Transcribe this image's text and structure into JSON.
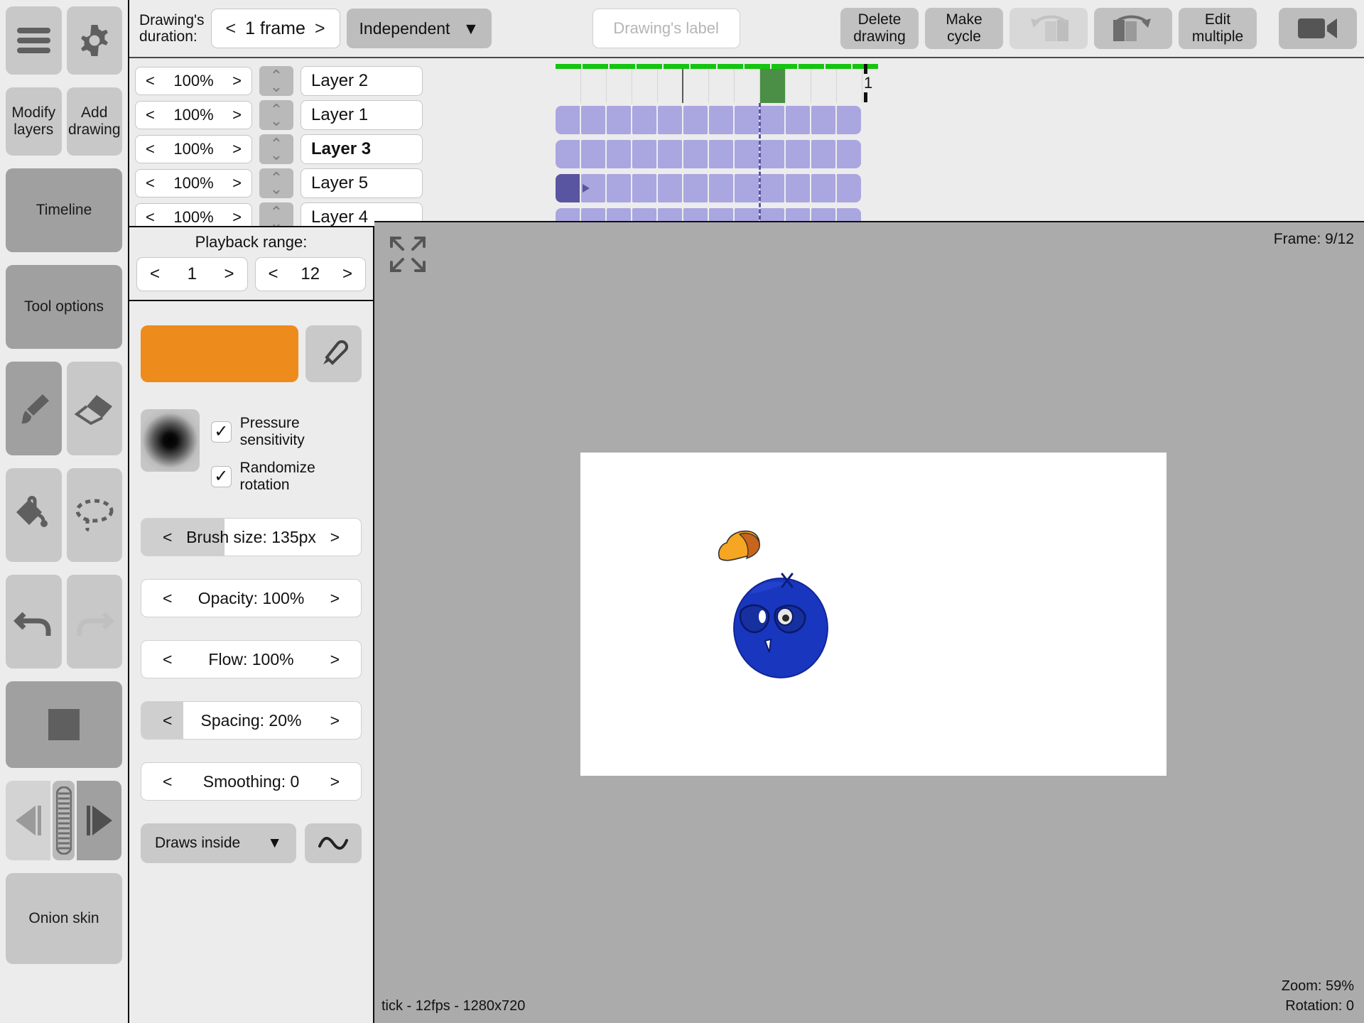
{
  "app": {
    "accent_orange": "#ED8B1C",
    "timeline_green": "#15c40f",
    "frame_purple": "#aaa6e0",
    "frame_purple_dark": "#5a55a0"
  },
  "left_rail": {
    "menu_button": {
      "name": "hamburger-menu",
      "label": ""
    },
    "settings_button": {
      "name": "settings-gear",
      "label": ""
    },
    "modify_layers": "Modify\nlayers",
    "modify_layers_line1": "Modify",
    "modify_layers_line2": "layers",
    "add_drawing_line1": "Add",
    "add_drawing_line2": "drawing",
    "timeline_button": "Timeline",
    "tool_options_button": "Tool options",
    "tools": [
      {
        "name": "brush-tool",
        "icon": "brush-icon",
        "active": true
      },
      {
        "name": "eraser-tool",
        "icon": "eraser-icon",
        "active": false
      },
      {
        "name": "fill-tool",
        "icon": "paint-bucket-icon",
        "active": false
      },
      {
        "name": "lasso-select-tool",
        "icon": "lasso-icon",
        "active": false
      }
    ],
    "undo_button": "undo-icon",
    "redo_button": "redo-icon",
    "shape_button": "square-shape-icon",
    "prev_frame_button": "prev-frame-icon",
    "next_frame_button": "next-frame-icon",
    "scrubber": "frame-scrubber",
    "onion_skin_button": "Onion skin"
  },
  "timeline_toolbar": {
    "duration_label_line1": "Drawing's",
    "duration_label_line2": "duration:",
    "duration_value": "1 frame",
    "prev_arrow": "<",
    "next_arrow": ">",
    "mode_dropdown": "Independent",
    "drawing_label_placeholder": "Drawing's label",
    "drawing_label_value": "",
    "delete_drawing_line1": "Delete",
    "delete_drawing_line2": "drawing",
    "make_cycle_line1": "Make",
    "make_cycle_line2": "cycle",
    "flip_back_button": "flip-back-icon",
    "flip_forward_button": "flip-forward-icon",
    "edit_multiple_line1": "Edit",
    "edit_multiple_line2": "multiple",
    "camera_button": "camera-icon"
  },
  "timeline": {
    "layers": [
      {
        "name": "Layer 2",
        "opacity": "100%",
        "selected": false
      },
      {
        "name": "Layer 1",
        "opacity": "100%",
        "selected": false
      },
      {
        "name": "Layer 3",
        "opacity": "100%",
        "selected": true
      },
      {
        "name": "Layer 5",
        "opacity": "100%",
        "selected": false
      },
      {
        "name": "Layer 4",
        "opacity": "100%",
        "selected": false
      }
    ],
    "total_columns": 12,
    "current_frame_column": 9,
    "end_marker_label": "1",
    "playhead_column": 9,
    "tick_column": 5
  },
  "playback": {
    "title": "Playback range:",
    "start": "1",
    "end": "12",
    "prev_arrow": "<",
    "next_arrow": ">"
  },
  "brush": {
    "color": "#ED8B1C",
    "eyedropper": "eyedropper-icon",
    "brush_preview": "soft-round-brush-preview",
    "pressure_sensitivity": {
      "label": "Pressure sensitivity",
      "checked": true
    },
    "randomize_rotation": {
      "label": "Randomize rotation",
      "checked": true
    },
    "sliders": [
      {
        "name": "brush-size-slider",
        "label": "Brush size:",
        "value": "135px",
        "fill_pct": 38
      },
      {
        "name": "opacity-slider",
        "label": "Opacity:",
        "value": "100%",
        "fill_pct": 0
      },
      {
        "name": "flow-slider",
        "label": "Flow:",
        "value": "100%",
        "fill_pct": 0
      },
      {
        "name": "spacing-slider",
        "label": "Spacing:",
        "value": "20%",
        "fill_pct": 19
      },
      {
        "name": "smoothing-slider",
        "label": "Smoothing:",
        "value": "0",
        "fill_pct": 0
      }
    ],
    "draws_mode": "Draws inside",
    "stroke_style_button": "wavy-line-icon"
  },
  "canvas": {
    "fit_icon": "fit-to-screen-icon",
    "frame_readout": "Frame: 9/12",
    "zoom_readout": "Zoom: 59%",
    "rotation_readout": "Rotation: 0",
    "status_readout": "tick - 12fps - 1280x720"
  }
}
